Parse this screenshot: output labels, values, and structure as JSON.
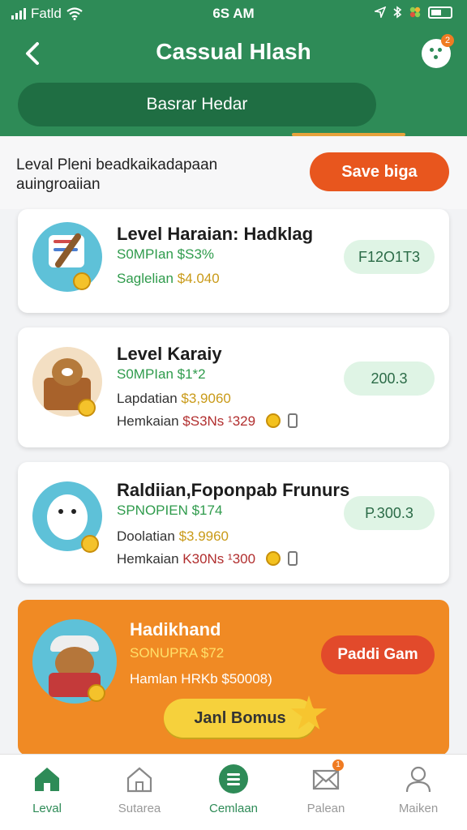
{
  "status_bar": {
    "carrier": "Fatld",
    "time": "6S AM"
  },
  "header": {
    "title": "Cassual Hlash",
    "search_label": "Basrar Hedar",
    "profile_badge": "2"
  },
  "intro": {
    "text": "Leval Pleni beadkaikadapaan auingroaiian",
    "save_button": "Save biga"
  },
  "cards": [
    {
      "title": "Level Haraian: Hadklag",
      "line1": "S0MPIan $S3%",
      "line2_label": "Saglelian",
      "line2_value": "$4.040",
      "price": "F12O1T3"
    },
    {
      "title": "Level Karaiy",
      "line1": "S0MPIan $1*2",
      "line2_label": "Lapdatian",
      "line2_value": "$3,9060",
      "line3_label": "Hemkaian",
      "line3_value": "$S3Ns ¹329",
      "price": "200.3"
    },
    {
      "title": "Raldiian,Foponpab Frunurs",
      "line1": "SPNOPIEN $174",
      "line2_label": "Doolatian",
      "line2_value": "$3.9960",
      "line3_label": "Hemkaian",
      "line3_value": "K30Ns ¹300",
      "price": "P.300.3"
    },
    {
      "title": "Hadikhand",
      "line1": "SONUPRA $72",
      "line2": "Hamlan  HRKb $50008)",
      "button": "Paddi Gam",
      "bonus_button": "Janl Bomus"
    }
  ],
  "tabbar": {
    "tabs": [
      {
        "label": "Leval",
        "icon": "home-icon",
        "active": true
      },
      {
        "label": "Sutarea",
        "icon": "house-outline-icon",
        "active": false
      },
      {
        "label": "Cemlaan",
        "icon": "list-circle-icon",
        "active": false
      },
      {
        "label": "Palean",
        "icon": "mail-icon",
        "badge": "1",
        "active": false
      },
      {
        "label": "Maiken",
        "icon": "user-icon",
        "active": false
      }
    ]
  },
  "colors": {
    "primary": "#2e8b57",
    "accent_orange": "#e8561e",
    "card_orange": "#f08a24",
    "price_pill": "#dff4e5"
  }
}
